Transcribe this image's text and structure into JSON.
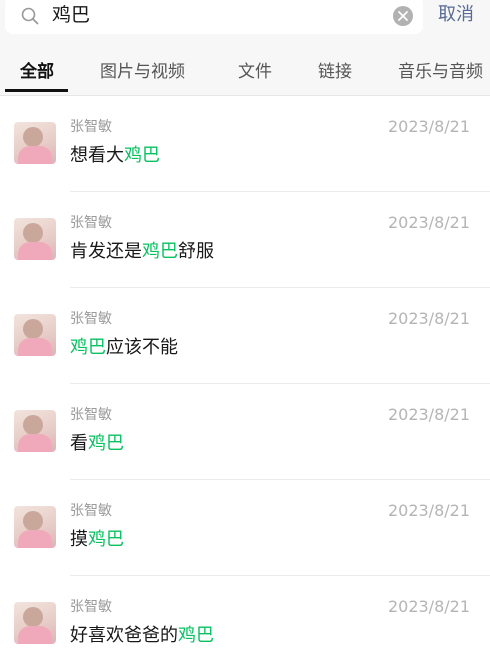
{
  "search": {
    "query": "鸡巴",
    "cancel_label": "取消",
    "icons": {
      "search": "search-icon",
      "clear": "clear-icon"
    }
  },
  "tabs": [
    {
      "label": "全部",
      "active": true
    },
    {
      "label": "图片与视频",
      "active": false
    },
    {
      "label": "文件",
      "active": false
    },
    {
      "label": "链接",
      "active": false
    },
    {
      "label": "音乐与音频",
      "active": false
    }
  ],
  "results": [
    {
      "name": "张智敏",
      "date": "2023/8/21",
      "parts": [
        {
          "text": "想看大",
          "hl": false
        },
        {
          "text": "鸡巴",
          "hl": true
        }
      ]
    },
    {
      "name": "张智敏",
      "date": "2023/8/21",
      "parts": [
        {
          "text": "肯发还是",
          "hl": false
        },
        {
          "text": "鸡巴",
          "hl": true
        },
        {
          "text": "舒服",
          "hl": false
        }
      ]
    },
    {
      "name": "张智敏",
      "date": "2023/8/21",
      "parts": [
        {
          "text": "鸡巴",
          "hl": true
        },
        {
          "text": "应该不能",
          "hl": false
        }
      ]
    },
    {
      "name": "张智敏",
      "date": "2023/8/21",
      "parts": [
        {
          "text": "看",
          "hl": false
        },
        {
          "text": "鸡巴",
          "hl": true
        }
      ]
    },
    {
      "name": "张智敏",
      "date": "2023/8/21",
      "parts": [
        {
          "text": "摸",
          "hl": false
        },
        {
          "text": "鸡巴",
          "hl": true
        }
      ]
    },
    {
      "name": "张智敏",
      "date": "2023/8/21",
      "parts": [
        {
          "text": "好喜欢爸爸的",
          "hl": false
        },
        {
          "text": "鸡巴",
          "hl": true
        }
      ]
    }
  ],
  "colors": {
    "highlight": "#07c160",
    "link": "#576b95",
    "active_tab": "#111111"
  }
}
